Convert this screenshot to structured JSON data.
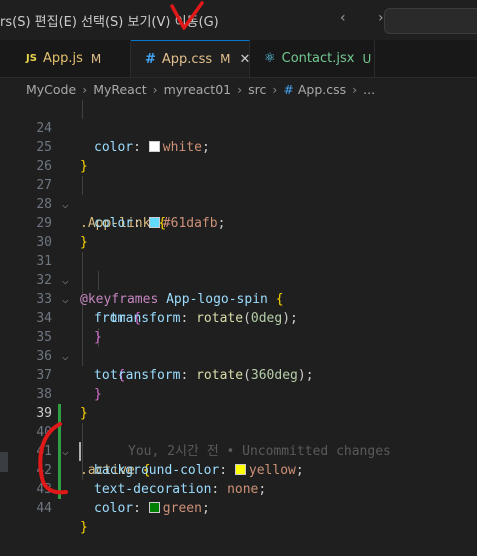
{
  "menubar": {
    "text": "rs(S)   편집(E)   선택(S)   보기(V)   이동(G)",
    "nav_arrows": "‹ ›"
  },
  "tabs": [
    {
      "icon": "JS",
      "label": "App.js",
      "status": "M"
    },
    {
      "icon": "#",
      "label": "App.css",
      "status": "M",
      "close": "✕"
    },
    {
      "icon": "⚛",
      "label": "Contact.jsx",
      "status": "U"
    }
  ],
  "breadcrumb": {
    "items": [
      "MyCode",
      "MyReact",
      "myreact01",
      "src"
    ],
    "file": "App.css",
    "more": "..."
  },
  "editor": {
    "line_numbers": [
      "24",
      "25",
      "26",
      "27",
      "28",
      "29",
      "30",
      "31",
      "32",
      "33",
      "34",
      "35",
      "36",
      "37",
      "38",
      "39",
      "40",
      "41",
      "42",
      "43",
      "44"
    ],
    "blame": "You, 2시간 전 • Uncommitted changes",
    "tokens": {
      "l24_prop": "color",
      "l24_val": "white",
      "l27_sel": ".App-link",
      "l28_prop": "color",
      "l28_val": "#61dafb",
      "l31_kw": "@keyframes",
      "l31_name": "App-logo-spin",
      "l32_kw": "from",
      "l33_prop": "transform",
      "l33_fn": "rotate",
      "l33_num": "0deg",
      "l35_kw": "to",
      "l36_prop": "transform",
      "l36_fn": "rotate",
      "l36_num": "360deg",
      "l40_sel": ".active",
      "l41_prop": "background-color",
      "l41_val": "yellow",
      "l42_prop": "text-decoration",
      "l42_val": "none",
      "l43_prop": "color",
      "l43_val": "green"
    },
    "swatches": {
      "white": "#ffffff",
      "cyan": "#61dafb",
      "yellow": "#ffff00",
      "green": "#008000"
    }
  },
  "colors": {
    "annotation_red": "#e01818",
    "git_modified": "#2ea043",
    "accent": "#0078d4"
  }
}
